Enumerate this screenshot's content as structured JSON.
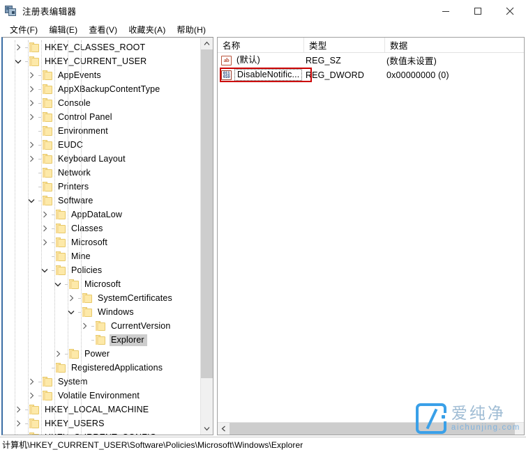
{
  "window": {
    "title": "注册表编辑器",
    "app_icon": "registry-editor-icon",
    "controls": {
      "minimize": "minimize-icon",
      "maximize": "maximize-icon",
      "close": "close-icon"
    }
  },
  "menubar": {
    "items": [
      {
        "label": "文件(F)"
      },
      {
        "label": "编辑(E)"
      },
      {
        "label": "查看(V)"
      },
      {
        "label": "收藏夹(A)"
      },
      {
        "label": "帮助(H)"
      }
    ]
  },
  "tree": {
    "nodes": [
      {
        "label": "HKEY_CLASSES_ROOT",
        "depth": 0,
        "state": "collapsed",
        "selected": false
      },
      {
        "label": "HKEY_CURRENT_USER",
        "depth": 0,
        "state": "expanded",
        "selected": false
      },
      {
        "label": "AppEvents",
        "depth": 1,
        "state": "collapsed",
        "selected": false
      },
      {
        "label": "AppXBackupContentType",
        "depth": 1,
        "state": "collapsed",
        "selected": false
      },
      {
        "label": "Console",
        "depth": 1,
        "state": "collapsed",
        "selected": false
      },
      {
        "label": "Control Panel",
        "depth": 1,
        "state": "collapsed",
        "selected": false
      },
      {
        "label": "Environment",
        "depth": 1,
        "state": "leaf",
        "selected": false
      },
      {
        "label": "EUDC",
        "depth": 1,
        "state": "collapsed",
        "selected": false
      },
      {
        "label": "Keyboard Layout",
        "depth": 1,
        "state": "collapsed",
        "selected": false
      },
      {
        "label": "Network",
        "depth": 1,
        "state": "leaf",
        "selected": false
      },
      {
        "label": "Printers",
        "depth": 1,
        "state": "leaf",
        "selected": false
      },
      {
        "label": "Software",
        "depth": 1,
        "state": "expanded",
        "selected": false
      },
      {
        "label": "AppDataLow",
        "depth": 2,
        "state": "collapsed",
        "selected": false
      },
      {
        "label": "Classes",
        "depth": 2,
        "state": "collapsed",
        "selected": false
      },
      {
        "label": "Microsoft",
        "depth": 2,
        "state": "collapsed",
        "selected": false
      },
      {
        "label": "Mine",
        "depth": 2,
        "state": "leaf",
        "selected": false
      },
      {
        "label": "Policies",
        "depth": 2,
        "state": "expanded",
        "selected": false
      },
      {
        "label": "Microsoft",
        "depth": 3,
        "state": "expanded",
        "selected": false
      },
      {
        "label": "SystemCertificates",
        "depth": 4,
        "state": "collapsed",
        "selected": false
      },
      {
        "label": "Windows",
        "depth": 4,
        "state": "expanded",
        "selected": false
      },
      {
        "label": "CurrentVersion",
        "depth": 5,
        "state": "collapsed",
        "selected": false
      },
      {
        "label": "Explorer",
        "depth": 5,
        "state": "leaf",
        "selected": true
      },
      {
        "label": "Power",
        "depth": 3,
        "state": "collapsed",
        "selected": false
      },
      {
        "label": "RegisteredApplications",
        "depth": 2,
        "state": "leaf",
        "selected": false
      },
      {
        "label": "System",
        "depth": 1,
        "state": "collapsed",
        "selected": false
      },
      {
        "label": "Volatile Environment",
        "depth": 1,
        "state": "collapsed",
        "selected": false
      },
      {
        "label": "HKEY_LOCAL_MACHINE",
        "depth": 0,
        "state": "collapsed",
        "selected": false
      },
      {
        "label": "HKEY_USERS",
        "depth": 0,
        "state": "collapsed",
        "selected": false
      },
      {
        "label": "HKEY_CURRENT_CONFIG",
        "depth": 0,
        "state": "collapsed",
        "selected": false
      }
    ],
    "scrollbar": {
      "up_arrow": "chevron-up-icon",
      "down_arrow": "chevron-down-icon"
    }
  },
  "list": {
    "columns": [
      {
        "label": "名称"
      },
      {
        "label": "类型"
      },
      {
        "label": "数据"
      }
    ],
    "rows": [
      {
        "icon": "string-value-icon",
        "name": "(默认)",
        "type": "REG_SZ",
        "data": "(数值未设置)",
        "focused": false,
        "annotated": false
      },
      {
        "icon": "dword-value-icon",
        "name": "DisableNotific...",
        "type": "REG_DWORD",
        "data": "0x00000000 (0)",
        "focused": true,
        "annotated": true
      }
    ],
    "scrollbar": {
      "left_arrow": "chevron-left-icon"
    }
  },
  "statusbar": {
    "path": "计算机\\HKEY_CURRENT_USER\\Software\\Policies\\Microsoft\\Windows\\Explorer"
  },
  "watermark": {
    "cn_text": "爱纯净",
    "en_text": "aichunjing.com",
    "logo": "aichunjing-logo"
  },
  "colors": {
    "annotation_red": "#cc0000",
    "selection_gray": "#cdcdcd",
    "folder_yellow": "#fde9a9",
    "pane_accent_blue": "#3b6ea5",
    "watermark_blue": "#3aa0e8"
  }
}
